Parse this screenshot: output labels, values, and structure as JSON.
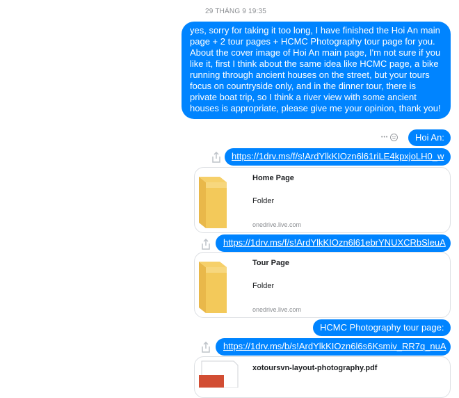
{
  "timestamp": "29 THÁNG 9 19:35",
  "messages": {
    "main_text": "yes, sorry for taking it too long, I have finished the Hoi An main page + 2 tour pages + HCMC Photography tour page for you. About the cover image of Hoi An main page, I'm not sure if you like it, first I think about the same idea like HCMC page, a bike running through ancient houses on the street, but your tours focus on countryside only, and in the dinner tour, there is private boat trip, so I think a river view with some ancient houses is appropriate, please give me your opinion, thank you!",
    "hoi_an_label": "Hoi An:",
    "link1": "https://1drv.ms/f/s!ArdYlkKIOzn6l61riLE4kpxjoLH0_w",
    "link2": "https://1drv.ms/f/s!ArdYlkKIOzn6l61ebrYNUXCRbSleuA",
    "hcmc_label": "HCMC Photography tour page:",
    "link3": "https://1drv.ms/b/s!ArdYlkKIOzn6l6s6Ksmiv_RR7q_nuA"
  },
  "cards": [
    {
      "title": "Home Page",
      "subtitle": "Folder",
      "domain": "onedrive.live.com"
    },
    {
      "title": "Tour Page",
      "subtitle": "Folder",
      "domain": "onedrive.live.com"
    },
    {
      "title": "xotoursvn-layout-photography.pdf"
    }
  ],
  "actions": {
    "more": "•••"
  },
  "colors": {
    "bubble": "#0084ff",
    "folder": "#f3c95a",
    "pdf": "#d24d33"
  },
  "icons": [
    "share-icon",
    "folder-icon",
    "pdf-icon",
    "emoji-icon",
    "more-icon"
  ]
}
